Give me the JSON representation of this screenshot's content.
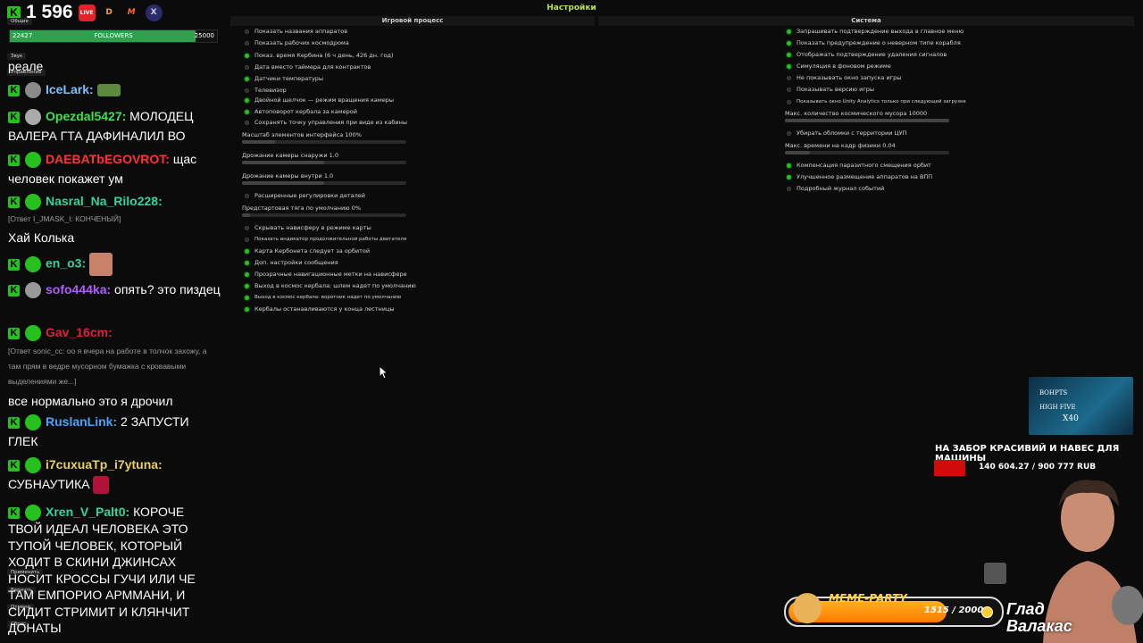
{
  "settings": {
    "title": "Настройки",
    "game_header": "Игровой процесс",
    "system_header": "Система",
    "game_options_a": [
      {
        "label": "Показать названия аппаратов",
        "on": false
      },
      {
        "label": "Показать рабочих космодрома",
        "on": false
      },
      {
        "label": "Показ. время Кербина (6 ч день, 426 дн. год)",
        "on": true
      },
      {
        "label": "Дата вместо таймера для контрактов",
        "on": false
      },
      {
        "label": "Датчики температуры",
        "on": true
      },
      {
        "label": "Телевизор",
        "on": false
      },
      {
        "label": "Двойной щелчок — режим вращения камеры",
        "on": true
      },
      {
        "label": "Автоповорот кербала за камерой",
        "on": true
      },
      {
        "label": "Сохранять точку управления при виде из кабины",
        "on": false
      }
    ],
    "sliders": [
      {
        "label": "Масштаб элементов интерфейса",
        "value": "100%",
        "fraction": 0.2
      },
      {
        "label": "Дрожание камеры снаружи",
        "value": "1.0",
        "fraction": 0.5
      },
      {
        "label": "Дрожание камеры внутри",
        "value": "1.0",
        "fraction": 0.5
      }
    ],
    "game_option_advanced": {
      "label": "Расширенные регулировки деталей",
      "on": false
    },
    "slider_thrust": {
      "label": "Предстартовая тяга по умолчанию",
      "value": "0%",
      "fraction": 0.05
    },
    "game_options_b": [
      {
        "label": "Скрывать нависферу в режиме карты",
        "on": false
      },
      {
        "label": "Показать индикатор продолжительной работы двигателя",
        "on": false
      },
      {
        "label": "Карта Кербонета следует за орбитой",
        "on": true
      },
      {
        "label": "Доп. настройки сообщения",
        "on": true
      },
      {
        "label": "Прозрачные навигационные метки на нависфере",
        "on": true
      },
      {
        "label": "Выход в космос кербала: шлем надет по умолчанию",
        "on": true
      },
      {
        "label": "Выход в космос кербала: воротник надет по умолчанию",
        "on": true
      },
      {
        "label": "Кербалы останавливаются у конца лестницы",
        "on": true
      }
    ],
    "system_options_a": [
      {
        "label": "Запрашивать подтверждение выхода в главное меню",
        "on": true
      },
      {
        "label": "Показать предупреждение о неверном типе корабля",
        "on": true
      },
      {
        "label": "Отображать подтверждение удаления сигналов",
        "on": true
      },
      {
        "label": "Симуляция в фоновом режиме",
        "on": true
      },
      {
        "label": "Не показывать окно запуска игры",
        "on": false
      },
      {
        "label": "Показывать версию игры",
        "on": false
      },
      {
        "label": "Показывать окно Unity Analytics только при следующей загрузке",
        "on": false
      }
    ],
    "debris_slider": {
      "label": "Макс. количество космического мусора",
      "value": "10000",
      "fraction": 1.0
    },
    "kpc_option": {
      "label": "Убирать обломки с территории ЦУП",
      "on": false
    },
    "physics_slider": {
      "label": "Макс. времени на кадр физики",
      "value": "0.04",
      "fraction": 0.15
    },
    "system_options_b": [
      {
        "label": "Компенсация паразитного смещения орбит",
        "on": true
      },
      {
        "label": "Улучшенное размещение аппаратов на ВПП",
        "on": true
      },
      {
        "label": "Подробный журнал событий",
        "on": false
      }
    ]
  },
  "viewer_count": "1 596",
  "platforms": {
    "live": "LIVE",
    "d": "D",
    "m": "M",
    "x": "X"
  },
  "followers": {
    "current": "22427",
    "label": "FOLLOWERS",
    "max": "25000",
    "fraction": 0.897
  },
  "side_tags": {
    "general": "Общие",
    "sound": "Звук",
    "control": "Управление",
    "apply": "Применить",
    "back": "Вернуть",
    "cancel": "Отмена",
    "reset": "Сброс"
  },
  "chat": {
    "first_line": "реале",
    "messages": [
      {
        "user": "IceLark:",
        "color": "#7cc0ff",
        "text": ""
      },
      {
        "user": "Opezdal5427:",
        "color": "#3ee04b",
        "text": "МОЛОДЕЦ ВАЛЕРА ГТА ДАФИНАЛИЛ ВО"
      },
      {
        "user": "DAEBATbEGOVROT:",
        "color": "#ff3333",
        "text": "щас человек покажет ум"
      },
      {
        "user": "Nasral_Na_Rilo228:",
        "color": "#35d2a0",
        "text": ""
      },
      {
        "reply": "[Ответ I_JMASK_I: КОНЧЕНЫЙ]",
        "text": "Хай Колька"
      },
      {
        "user": "en_o3:",
        "color": "#35d2a0",
        "text": ""
      },
      {
        "user": "sofo444ka:",
        "color": "#b05cff",
        "text": "опять? это пиздец"
      },
      {
        "user": "Gav_16cm:",
        "color": "#e0203a",
        "text": ""
      },
      {
        "reply": "[Ответ sonic_cc: оо я вчера на работе в толчок захожу, а там прям в ведре мусорном бумажка с кровавыми выделениями же...]",
        "text": "все нормально это я дрочил"
      },
      {
        "user": "RuslanLink:",
        "color": "#4aa3ff",
        "text": "2 ЗАПУСТИ ГЛЕК"
      },
      {
        "user": "i7cuxuaTp_i7ytuna:",
        "color": "#e8d060",
        "text": "СУБНАУТИКА"
      },
      {
        "user": "Xren_V_Palt0:",
        "color": "#35d2a0",
        "text": "КОРОЧЕ ТВОЙ ИДЕАЛ ЧЕЛОВЕКА ЭТО ТУПОЙ ЧЕЛОВЕК, КОТОРЫЙ ХОДИТ В СКИНИ ДЖИНСАХ НОСИТ КРОССЫ ГУЧИ ИЛИ ЧЕ ТАМ ЕМПОРИО АРММАНИ, И СИДИТ СТРИМИТ И КЛЯНЧИТ ДОНАТЫ"
      }
    ]
  },
  "promo": {
    "line1": "ВОНРТS",
    "line2": "HIGH FIVE",
    "line3": "X40"
  },
  "goal": {
    "title": "НА ЗАБОР КРАСИВИЙ И НАВЕС ДЛЯ МАШИНЫ",
    "amount": "140 604.27 / 900 777 RUB",
    "fraction": 0.156
  },
  "meme_party": {
    "title": "MEME-PARTY",
    "progress": "1515 / 2000",
    "fraction": 0.7575
  },
  "streamer_name": [
    "Глад",
    "Валакас"
  ]
}
